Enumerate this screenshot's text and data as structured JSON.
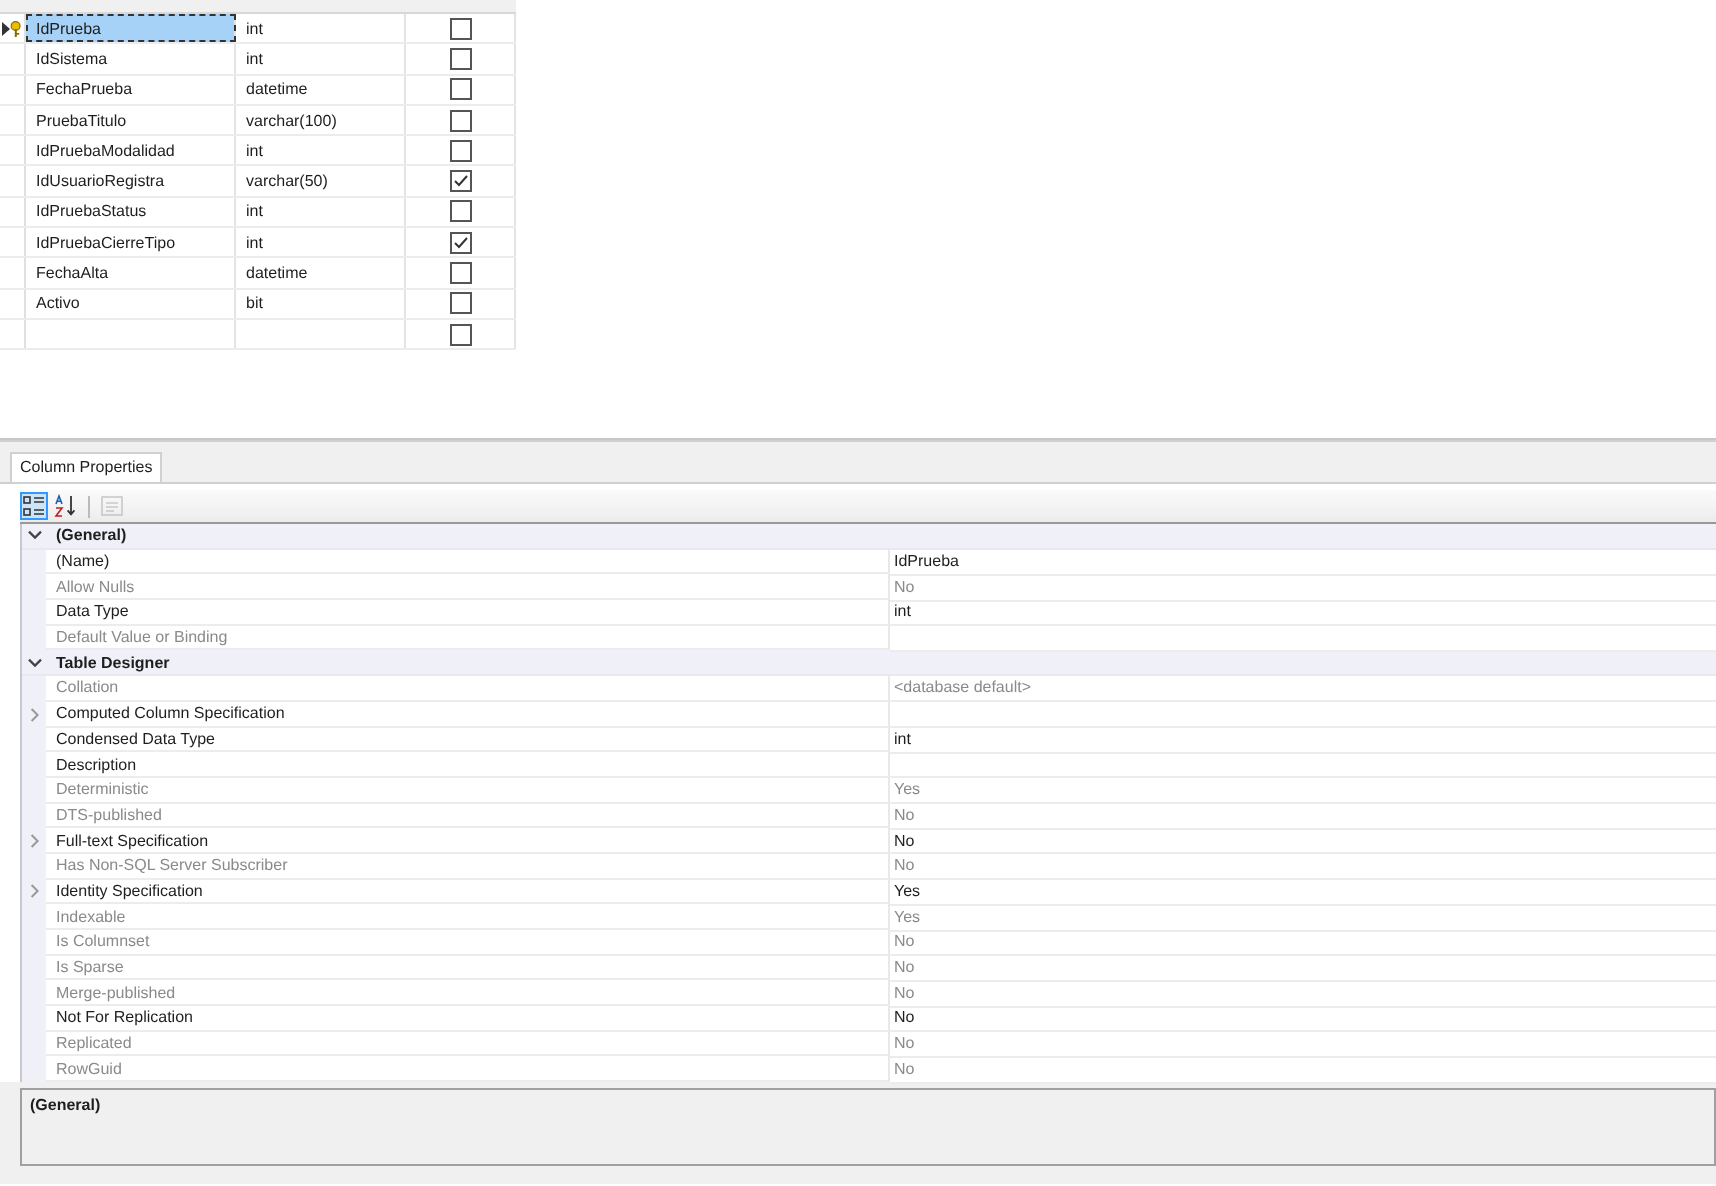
{
  "columns_grid": {
    "rows": [
      {
        "name": "IdPrueba",
        "data_type": "int",
        "allow_nulls": false,
        "selected": true,
        "primary_key": true
      },
      {
        "name": "IdSistema",
        "data_type": "int",
        "allow_nulls": false,
        "selected": false,
        "primary_key": false
      },
      {
        "name": "FechaPrueba",
        "data_type": "datetime",
        "allow_nulls": false,
        "selected": false,
        "primary_key": false
      },
      {
        "name": "PruebaTitulo",
        "data_type": "varchar(100)",
        "allow_nulls": false,
        "selected": false,
        "primary_key": false
      },
      {
        "name": "IdPruebaModalidad",
        "data_type": "int",
        "allow_nulls": false,
        "selected": false,
        "primary_key": false
      },
      {
        "name": "IdUsuarioRegistra",
        "data_type": "varchar(50)",
        "allow_nulls": true,
        "selected": false,
        "primary_key": false
      },
      {
        "name": "IdPruebaStatus",
        "data_type": "int",
        "allow_nulls": false,
        "selected": false,
        "primary_key": false
      },
      {
        "name": "IdPruebaCierreTipo",
        "data_type": "int",
        "allow_nulls": true,
        "selected": false,
        "primary_key": false
      },
      {
        "name": "FechaAlta",
        "data_type": "datetime",
        "allow_nulls": false,
        "selected": false,
        "primary_key": false
      },
      {
        "name": "Activo",
        "data_type": "bit",
        "allow_nulls": false,
        "selected": false,
        "primary_key": false
      }
    ],
    "new_row": {
      "allow_nulls": false
    }
  },
  "properties_panel": {
    "tabs": [
      {
        "label": "Column Properties",
        "selected": true
      }
    ],
    "toolbar": [
      {
        "kind": "categorized",
        "selected": true,
        "disabled": false
      },
      {
        "kind": "alphabetical",
        "selected": false,
        "disabled": false
      },
      {
        "kind": "pages",
        "selected": false,
        "disabled": true
      }
    ],
    "groups": [
      {
        "name": "(General)",
        "expanded": true,
        "properties": [
          {
            "name": "(Name)",
            "value": "IdPrueba",
            "disabled": false,
            "kind": "simple"
          },
          {
            "name": "Allow Nulls",
            "value": "No",
            "disabled": true,
            "kind": "simple"
          },
          {
            "name": "Data Type",
            "value": "int",
            "disabled": false,
            "kind": "simple"
          },
          {
            "name": "Default Value or Binding",
            "disabled": true,
            "kind": "simple"
          }
        ]
      },
      {
        "name": "Table Designer",
        "expanded": true,
        "properties": [
          {
            "name": "Collation",
            "value": "<database default>",
            "disabled": true,
            "kind": "simple"
          },
          {
            "name": "Computed Column Specification",
            "disabled": false,
            "kind": "expandable",
            "expanded": false
          },
          {
            "name": "Condensed Data Type",
            "value": "int",
            "disabled": false,
            "kind": "simple"
          },
          {
            "name": "Description",
            "disabled": false,
            "kind": "simple"
          },
          {
            "name": "Deterministic",
            "value": "Yes",
            "disabled": true,
            "kind": "simple"
          },
          {
            "name": "DTS-published",
            "value": "No",
            "disabled": true,
            "kind": "simple"
          },
          {
            "name": "Full-text Specification",
            "value": "No",
            "disabled": false,
            "kind": "expandable",
            "expanded": false
          },
          {
            "name": "Has Non-SQL Server Subscriber",
            "value": "No",
            "disabled": true,
            "kind": "simple"
          },
          {
            "name": "Identity Specification",
            "value": "Yes",
            "disabled": false,
            "kind": "expandable",
            "expanded": false
          },
          {
            "name": "Indexable",
            "value": "Yes",
            "disabled": true,
            "kind": "simple"
          },
          {
            "name": "Is Columnset",
            "value": "No",
            "disabled": true,
            "kind": "simple"
          },
          {
            "name": "Is Sparse",
            "value": "No",
            "disabled": true,
            "kind": "simple"
          },
          {
            "name": "Merge-published",
            "value": "No",
            "disabled": true,
            "kind": "simple"
          },
          {
            "name": "Not For Replication",
            "value": "No",
            "disabled": false,
            "kind": "simple"
          },
          {
            "name": "Replicated",
            "value": "No",
            "disabled": true,
            "kind": "simple"
          },
          {
            "name": "RowGuid",
            "value": "No",
            "disabled": true,
            "kind": "simple"
          }
        ]
      }
    ],
    "description": {
      "title": "(General)"
    }
  }
}
